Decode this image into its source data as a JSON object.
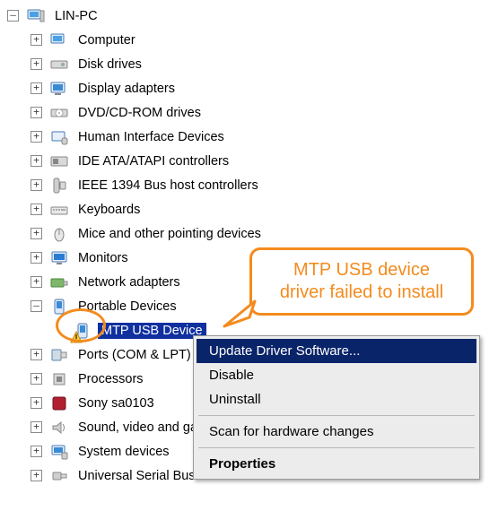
{
  "root": {
    "label": "LIN-PC"
  },
  "categories": [
    {
      "label": "Computer",
      "expanded": false
    },
    {
      "label": "Disk drives",
      "expanded": false
    },
    {
      "label": "Display adapters",
      "expanded": false
    },
    {
      "label": "DVD/CD-ROM drives",
      "expanded": false
    },
    {
      "label": "Human Interface Devices",
      "expanded": false
    },
    {
      "label": "IDE ATA/ATAPI controllers",
      "expanded": false
    },
    {
      "label": "IEEE 1394 Bus host controllers",
      "expanded": false
    },
    {
      "label": "Keyboards",
      "expanded": false
    },
    {
      "label": "Mice and other pointing devices",
      "expanded": false
    },
    {
      "label": "Monitors",
      "expanded": false
    },
    {
      "label": "Network adapters",
      "expanded": false
    },
    {
      "label": "Portable Devices",
      "expanded": true
    },
    {
      "label": "Ports (COM & LPT)",
      "expanded": false
    },
    {
      "label": "Processors",
      "expanded": false
    },
    {
      "label": "Sony sa0103",
      "expanded": false
    },
    {
      "label": "Sound, video and game controllers",
      "expanded": false
    },
    {
      "label": "System devices",
      "expanded": false
    },
    {
      "label": "Universal Serial Bus controllers",
      "expanded": false
    }
  ],
  "selected_device": {
    "label": "MTP USB Device",
    "has_warning": true
  },
  "callout": {
    "line1": "MTP USB device",
    "line2": "driver failed to install"
  },
  "context_menu": {
    "items": [
      {
        "label": "Update Driver Software...",
        "hover": true
      },
      {
        "label": "Disable"
      },
      {
        "label": "Uninstall"
      }
    ],
    "separator": true,
    "items2": [
      {
        "label": "Scan for hardware changes"
      }
    ],
    "separator2": true,
    "items3": [
      {
        "label": "Properties",
        "bold": true
      }
    ]
  },
  "colors": {
    "accent": "#f38b1e",
    "selection": "#1030a0"
  }
}
